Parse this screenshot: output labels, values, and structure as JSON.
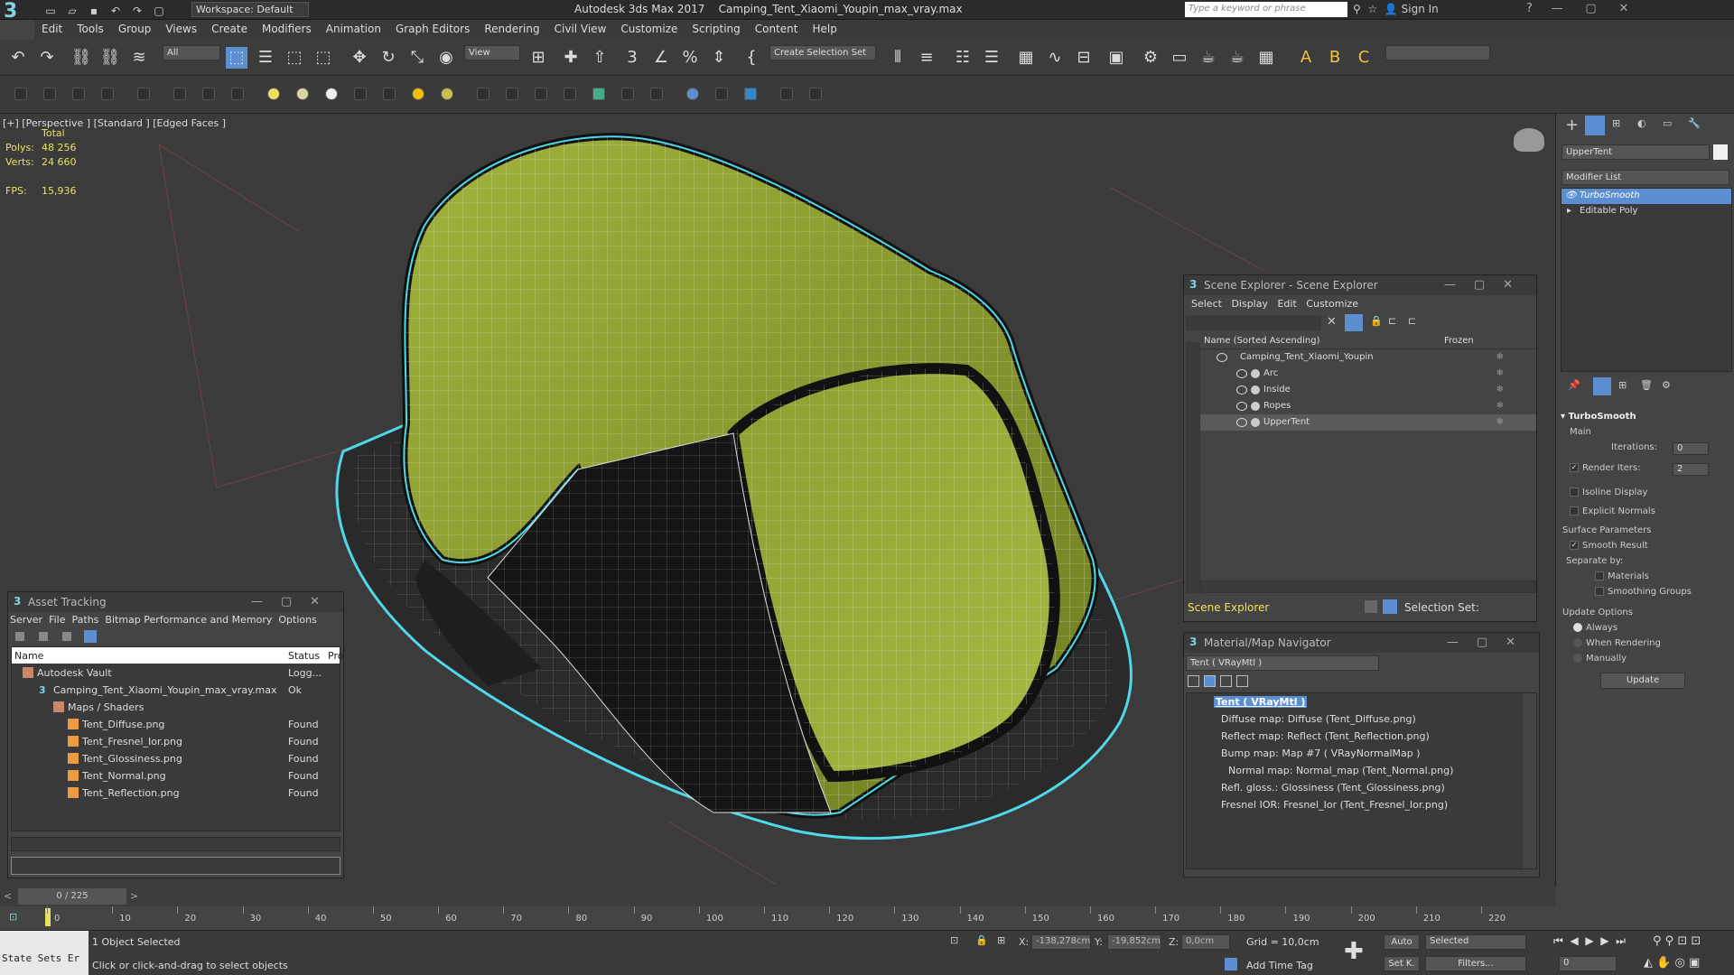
{
  "app": {
    "workspace": "Workspace: Default",
    "title": "Autodesk 3ds Max 2017",
    "filename": "Camping_Tent_Xiaomi_Youpin_max_vray.max",
    "search_placeholder": "Type a keyword or phrase",
    "sign_in": "Sign In"
  },
  "menu": [
    "Edit",
    "Tools",
    "Group",
    "Views",
    "Create",
    "Modifiers",
    "Animation",
    "Graph Editors",
    "Rendering",
    "Civil View",
    "Customize",
    "Scripting",
    "Content",
    "Help"
  ],
  "toolbar": {
    "filter": "All",
    "view": "View",
    "selection_set": "Create Selection Set"
  },
  "viewport": {
    "label": "[+] [Perspective ] [Standard ] [Edged Faces ]",
    "stats_header": "Total",
    "polys_label": "Polys:",
    "polys_value": "48 256",
    "verts_label": "Verts:",
    "verts_value": "24 660",
    "fps_label": "FPS:",
    "fps_value": "15,936"
  },
  "command_panel": {
    "object_name": "UpperTent",
    "modifier_list": "Modifier List",
    "stack": [
      "TurboSmooth",
      "Editable Poly"
    ],
    "turbosmooth": {
      "title": "TurboSmooth",
      "main": "Main",
      "iterations_label": "Iterations:",
      "iterations_value": "0",
      "render_iters_label": "Render Iters:",
      "render_iters_value": "2",
      "isoline": "Isoline Display",
      "explicit": "Explicit Normals",
      "surface": "Surface Parameters",
      "smooth_result": "Smooth Result",
      "separate_by": "Separate by:",
      "materials": "Materials",
      "smoothing_groups": "Smoothing Groups",
      "update_options": "Update Options",
      "always": "Always",
      "when_rendering": "When Rendering",
      "manually": "Manually",
      "update_btn": "Update"
    }
  },
  "scene_explorer": {
    "title": "Scene Explorer - Scene Explorer",
    "menu": [
      "Select",
      "Display",
      "Edit",
      "Customize"
    ],
    "col_name": "Name (Sorted Ascending)",
    "col_frozen": "Frozen",
    "root": "Camping_Tent_Xiaomi_Youpin",
    "items": [
      "Arc",
      "Inside",
      "Ropes",
      "UpperTent"
    ],
    "footer_label": "Scene Explorer",
    "selection_set": "Selection Set:"
  },
  "asset_tracking": {
    "title": "Asset Tracking",
    "menu": [
      "Server",
      "File",
      "Paths",
      "Bitmap Performance and Memory",
      "Options"
    ],
    "col_name": "Name",
    "col_status": "Status",
    "col_pro": "Pro",
    "rows": [
      {
        "name": "Autodesk Vault",
        "status": "Logg..."
      },
      {
        "name": "Camping_Tent_Xiaomi_Youpin_max_vray.max",
        "status": "Ok"
      },
      {
        "name": "Maps / Shaders",
        "status": ""
      },
      {
        "name": "Tent_Diffuse.png",
        "status": "Found"
      },
      {
        "name": "Tent_Fresnel_Ior.png",
        "status": "Found"
      },
      {
        "name": "Tent_Glossiness.png",
        "status": "Found"
      },
      {
        "name": "Tent_Normal.png",
        "status": "Found"
      },
      {
        "name": "Tent_Reflection.png",
        "status": "Found"
      }
    ]
  },
  "material_nav": {
    "title": "Material/Map Navigator",
    "current": "Tent  ( VRayMtl )",
    "rows": [
      "Tent  ( VRayMtl )",
      "Diffuse map: Diffuse (Tent_Diffuse.png)",
      "Reflect map: Reflect (Tent_Reflection.png)",
      "Bump map: Map #7  ( VRayNormalMap )",
      "Normal map: Normal_map (Tent_Normal.png)",
      "Refl. gloss.: Glossiness (Tent_Glossiness.png)",
      "Fresnel IOR: Fresnel_Ior (Tent_Fresnel_Ior.png)"
    ]
  },
  "timeline": {
    "frame": "0 / 225",
    "ticks": [
      "0",
      "10",
      "20",
      "30",
      "40",
      "50",
      "60",
      "70",
      "80",
      "90",
      "100",
      "110",
      "120",
      "130",
      "140",
      "150",
      "160",
      "170",
      "180",
      "190",
      "200",
      "210",
      "220"
    ]
  },
  "status": {
    "state_sets": "State Sets Er",
    "selected": "1 Object Selected",
    "hint": "Click or click-and-drag to select objects",
    "x_label": "X:",
    "x_value": "-138,278cm",
    "y_label": "Y:",
    "y_value": "-19,852cm",
    "z_label": "Z:",
    "z_value": "0,0cm",
    "grid": "Grid = 10,0cm",
    "add_time_tag": "Add Time Tag",
    "auto": "Auto",
    "set_k": "Set K.",
    "selected_dd": "Selected",
    "filters": "Filters...",
    "frame_value": "0"
  },
  "colors": {
    "selection": "#5b8fd1",
    "tent_green": "#8a9a2e",
    "outline": "#4fd8e8",
    "stats": "#e8e060"
  }
}
